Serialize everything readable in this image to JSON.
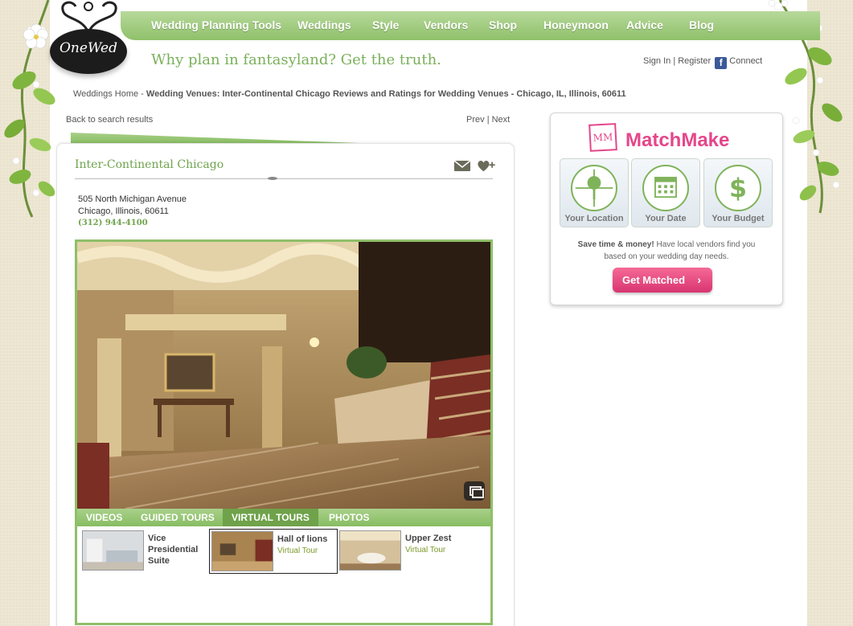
{
  "brand": {
    "logo_text": "OneWed",
    "tagline": "Why plan in fantasyland? Get the truth."
  },
  "nav": {
    "items": [
      {
        "label": "Wedding Planning Tools"
      },
      {
        "label": "Weddings"
      },
      {
        "label": "Style"
      },
      {
        "label": "Vendors"
      },
      {
        "label": "Shop"
      },
      {
        "label": "Honeymoon"
      },
      {
        "label": "Advice"
      },
      {
        "label": "Blog"
      }
    ]
  },
  "account": {
    "sign_in": "Sign In",
    "sep": "|",
    "register": "Register",
    "connect": "Connect",
    "fb_glyph": "f"
  },
  "breadcrumb": {
    "home": "Weddings Home",
    "sep": " - ",
    "current": "Wedding Venues: Inter-Continental Chicago Reviews and Ratings for Wedding Venues - Chicago, IL, Illinois, 60611"
  },
  "results_nav": {
    "back": "Back to search results",
    "prev": "Prev",
    "sep": "|",
    "next": "Next"
  },
  "venue": {
    "name": "Inter-Continental Chicago",
    "address_line1": "505 North Michigan Avenue",
    "address_line2": "Chicago, Illinois, 60611",
    "phone": "(312) 944-4100",
    "icons": [
      "mail-icon",
      "heart-plus-icon",
      "expand-icon"
    ]
  },
  "media": {
    "tabs": [
      {
        "label": "VIDEOS"
      },
      {
        "label": "GUIDED TOURS"
      },
      {
        "label": "VIRTUAL TOURS"
      },
      {
        "label": "PHOTOS"
      }
    ],
    "active_tab": "VIRTUAL TOURS",
    "thumbnails": [
      {
        "title": "Vice Presidential Suite",
        "subtitle": ""
      },
      {
        "title": "Hall of lions",
        "subtitle": "Virtual Tour"
      },
      {
        "title": "Upper Zest",
        "subtitle": "Virtual Tour"
      }
    ],
    "selected_thumbnail": "Hall of lions"
  },
  "matchmake": {
    "logo": "MM",
    "title": "MatchMake",
    "cards": [
      {
        "label": "Your Location",
        "icon": "location-pin-icon"
      },
      {
        "label": "Your Date",
        "icon": "calendar-icon"
      },
      {
        "label": "Your Budget",
        "icon": "dollar-icon"
      }
    ],
    "desc_bold": "Save time & money!",
    "desc_rest": " Have local vendors find you based on your wedding day needs.",
    "button": "Get Matched",
    "button_chevron": "›"
  },
  "colors": {
    "green": "#8fc16a",
    "pink": "#e5468a",
    "beige": "#efe8d3"
  }
}
